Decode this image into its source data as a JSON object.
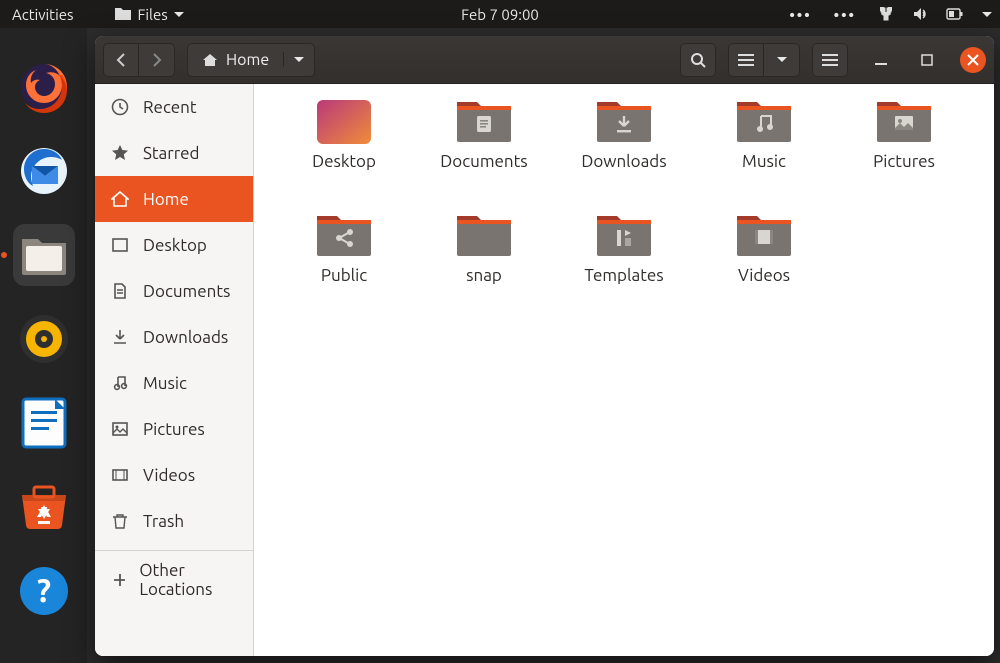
{
  "topbar": {
    "activities": "Activities",
    "files_label": "Files",
    "clock": "Feb 7  09:00"
  },
  "window": {
    "path_label": "Home"
  },
  "sidebar": {
    "items": [
      {
        "label": "Recent"
      },
      {
        "label": "Starred"
      },
      {
        "label": "Home"
      },
      {
        "label": "Desktop"
      },
      {
        "label": "Documents"
      },
      {
        "label": "Downloads"
      },
      {
        "label": "Music"
      },
      {
        "label": "Pictures"
      },
      {
        "label": "Videos"
      },
      {
        "label": "Trash"
      }
    ],
    "other_locations": "Other Locations"
  },
  "files": [
    {
      "name": "Desktop",
      "icon": "desktop"
    },
    {
      "name": "Documents",
      "icon": "documents"
    },
    {
      "name": "Downloads",
      "icon": "downloads"
    },
    {
      "name": "Music",
      "icon": "music"
    },
    {
      "name": "Pictures",
      "icon": "pictures"
    },
    {
      "name": "Public",
      "icon": "public"
    },
    {
      "name": "snap",
      "icon": "folder"
    },
    {
      "name": "Templates",
      "icon": "templates"
    },
    {
      "name": "Videos",
      "icon": "videos"
    }
  ]
}
